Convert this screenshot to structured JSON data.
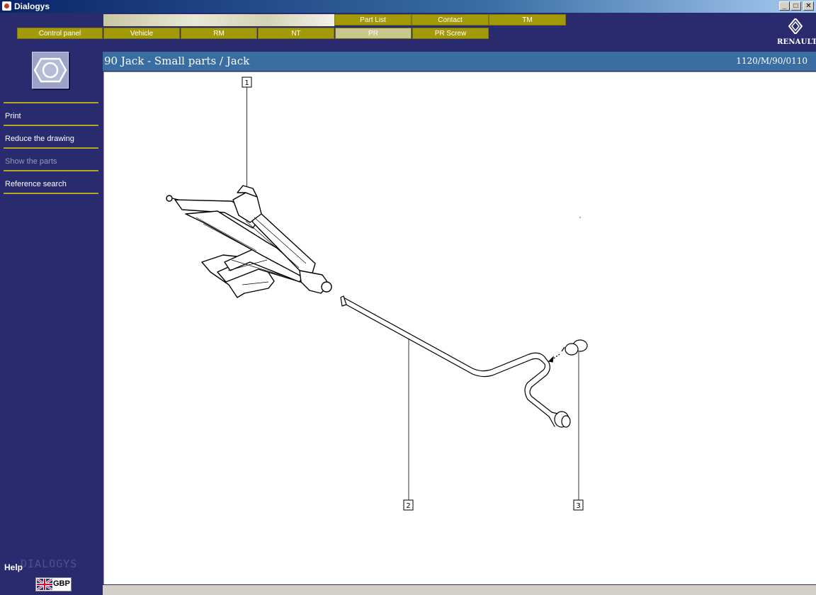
{
  "window": {
    "title": "Dialogys",
    "min": "_",
    "max": "□",
    "close": "✕"
  },
  "tabs_top": [
    {
      "label": "Part List"
    },
    {
      "label": "Contact"
    },
    {
      "label": "TM"
    }
  ],
  "tabs_main": [
    {
      "label": "Control panel"
    },
    {
      "label": "Vehicle"
    },
    {
      "label": "RM"
    },
    {
      "label": "NT"
    },
    {
      "label": "PR",
      "active": true
    },
    {
      "label": "PR Screw"
    }
  ],
  "brand": "RENAULT",
  "sidebar": {
    "icon": "hex-nut-icon",
    "items": [
      {
        "label": "Print",
        "enabled": true
      },
      {
        "label": "Reduce the drawing",
        "enabled": true
      },
      {
        "label": "Show the parts",
        "enabled": false
      },
      {
        "label": "Reference search",
        "enabled": true
      }
    ],
    "help": "Help",
    "watermark": "DIALOGYS",
    "language": "GBP"
  },
  "content": {
    "title": "90 Jack - Small parts / Jack",
    "reference": "1120/M/90/0110",
    "callouts": [
      "1",
      "2",
      "3"
    ]
  },
  "colors": {
    "background": "#2a2a6e",
    "tab": "#a39a0a",
    "header": "#3a6da2"
  }
}
